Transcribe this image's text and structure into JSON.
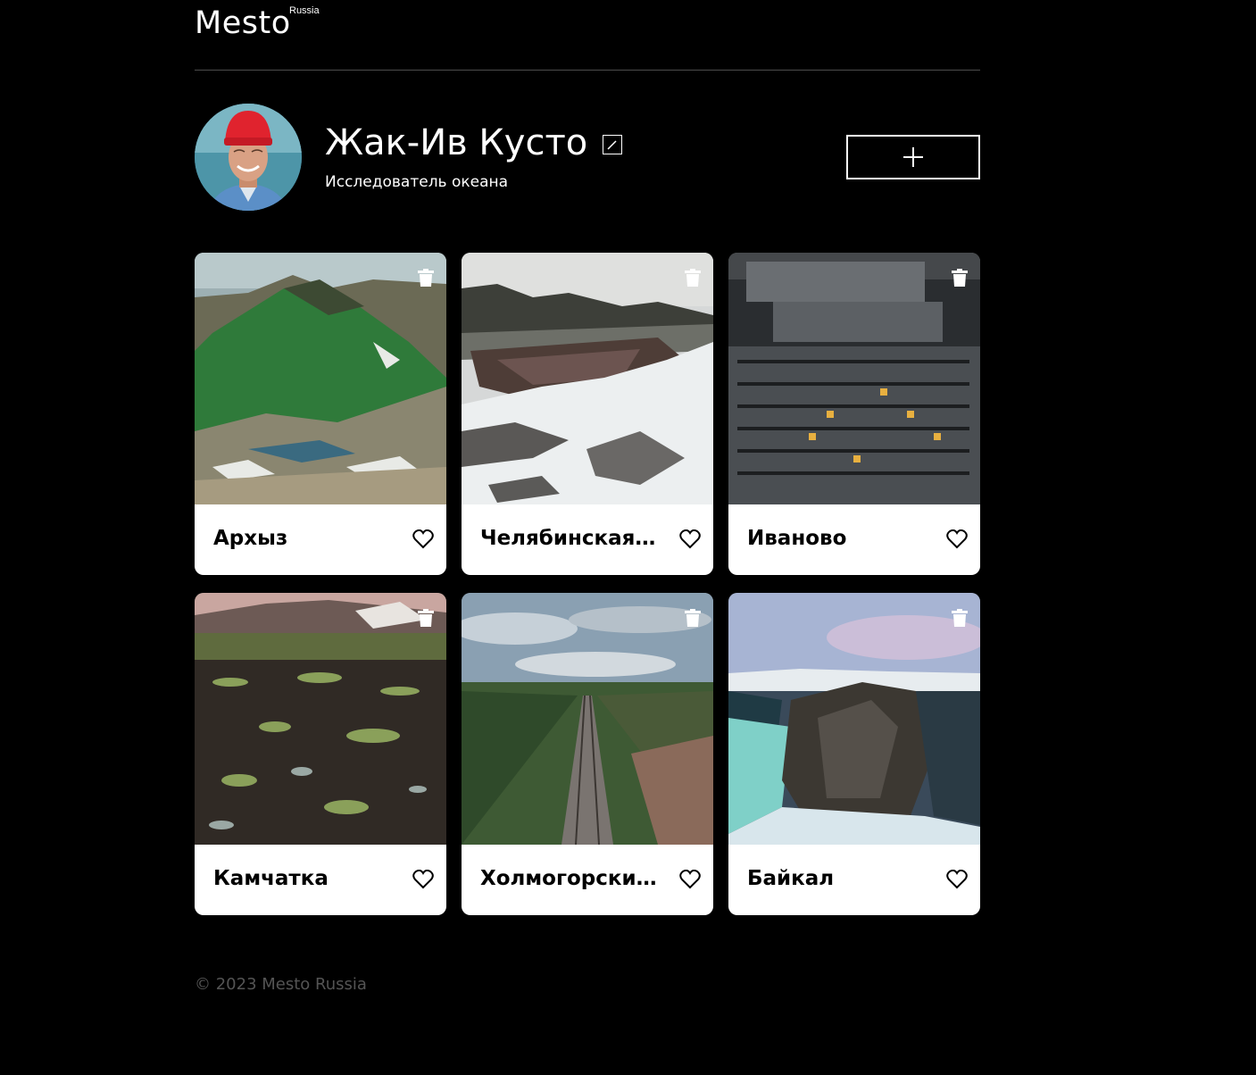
{
  "header": {
    "logo": "Mesto",
    "logo_sup": "Russia"
  },
  "profile": {
    "name": "Жак-Ив Кусто",
    "about": "Исследователь океана",
    "edit_icon": "pencil-icon",
    "add_icon": "plus-icon"
  },
  "cards": [
    {
      "title": "Архыз",
      "scene": "mountains-green"
    },
    {
      "title": "Челябинская …",
      "scene": "snowy-river"
    },
    {
      "title": "Иваново",
      "scene": "apartment-blocks"
    },
    {
      "title": "Камчатка",
      "scene": "volcano-tundra"
    },
    {
      "title": "Холмогорски…",
      "scene": "railway-forest"
    },
    {
      "title": "Байкал",
      "scene": "cliff-ice"
    }
  ],
  "footer": {
    "copyright": "© 2023 Mesto Russia"
  },
  "colors": {
    "background": "#000000",
    "card": "#ffffff",
    "footer_text": "#545454"
  }
}
